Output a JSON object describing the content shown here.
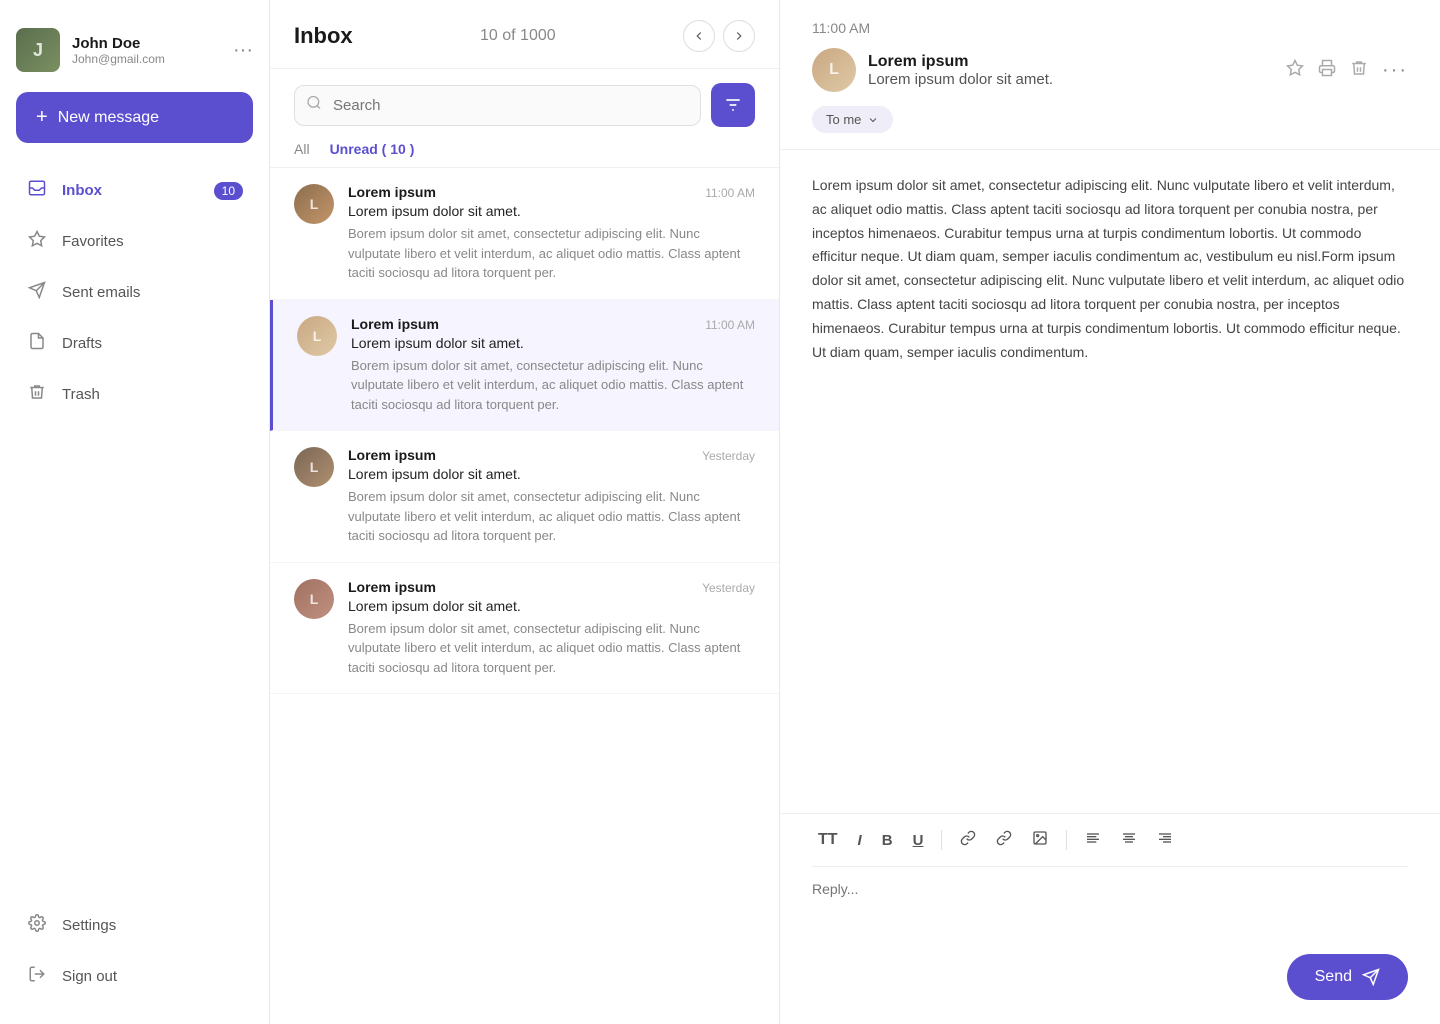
{
  "sidebar": {
    "user": {
      "name": "John Doe",
      "email": "John@gmail.com"
    },
    "new_message_label": "New message",
    "nav_items": [
      {
        "id": "inbox",
        "label": "Inbox",
        "icon": "📥",
        "badge": 10,
        "active": true
      },
      {
        "id": "favorites",
        "label": "Favorites",
        "icon": "☆",
        "badge": null,
        "active": false
      },
      {
        "id": "sent",
        "label": "Sent emails",
        "icon": "▷",
        "badge": null,
        "active": false
      },
      {
        "id": "drafts",
        "label": "Drafts",
        "icon": "📄",
        "badge": null,
        "active": false
      },
      {
        "id": "trash",
        "label": "Trash",
        "icon": "🗑",
        "badge": null,
        "active": false
      }
    ],
    "bottom_items": [
      {
        "id": "settings",
        "label": "Settings",
        "icon": "⚙"
      },
      {
        "id": "signout",
        "label": "Sign out",
        "icon": "↪"
      }
    ]
  },
  "email_list": {
    "title": "Inbox",
    "count": "10 of 1000",
    "search_placeholder": "Search",
    "tab_all": "All",
    "tab_unread": "Unread ( 10 )",
    "emails": [
      {
        "id": 1,
        "sender": "Lorem ipsum",
        "subject": "Lorem ipsum dolor sit amet.",
        "preview": "Borem ipsum dolor sit amet, consectetur adipiscing elit. Nunc vulputate libero et velit interdum, ac aliquet odio mattis. Class aptent taciti sociosqu ad litora torquent per.",
        "time": "11:00 AM",
        "selected": false,
        "avatar_class": "face1"
      },
      {
        "id": 2,
        "sender": "Lorem ipsum",
        "subject": "Lorem ipsum dolor sit amet.",
        "preview": "Borem ipsum dolor sit amet, consectetur adipiscing elit. Nunc vulputate libero et velit interdum, ac aliquet odio mattis. Class aptent taciti sociosqu ad litora torquent per.",
        "time": "11:00 AM",
        "selected": true,
        "avatar_class": "face2"
      },
      {
        "id": 3,
        "sender": "Lorem ipsum",
        "subject": "Lorem ipsum dolor sit amet.",
        "preview": "Borem ipsum dolor sit amet, consectetur adipiscing elit. Nunc vulputate libero et velit interdum, ac aliquet odio mattis. Class aptent taciti sociosqu ad litora torquent per.",
        "time": "Yesterday",
        "selected": false,
        "avatar_class": "face3"
      },
      {
        "id": 4,
        "sender": "Lorem ipsum",
        "subject": "Lorem ipsum dolor sit amet.",
        "preview": "Borem ipsum dolor sit amet, consectetur adipiscing elit. Nunc vulputate libero et velit interdum, ac aliquet odio mattis. Class aptent taciti sociosqu ad litora torquent per.",
        "time": "Yesterday",
        "selected": false,
        "avatar_class": "face4"
      }
    ]
  },
  "email_detail": {
    "time": "11:00 AM",
    "sender_name": "Lorem ipsum",
    "subject": "Lorem ipsum dolor sit amet.",
    "to_label": "To me",
    "body": "Lorem ipsum dolor sit amet, consectetur adipiscing elit. Nunc vulputate libero et velit interdum, ac aliquet odio mattis. Class aptent taciti sociosqu ad litora torquent per conubia nostra, per inceptos himenaeos. Curabitur tempus urna at turpis condimentum lobortis. Ut commodo efficitur neque. Ut diam quam, semper iaculis condimentum ac, vestibulum eu nisl.Form ipsum dolor sit amet, consectetur adipiscing elit. Nunc vulputate libero et velit interdum, ac aliquet odio mattis. Class aptent taciti sociosqu ad litora torquent per conubia nostra, per inceptos himenaeos. Curabitur tempus urna at turpis condimentum lobortis. Ut commodo efficitur neque. Ut diam quam, semper iaculis condimentum.",
    "reply_placeholder": "Reply...",
    "send_label": "Send",
    "toolbar": {
      "text": "TT",
      "italic": "I",
      "bold": "B",
      "underline": "U",
      "link1": "🔗",
      "link2": "🔗",
      "image": "🖼",
      "align_left": "≡",
      "align_center": "≡",
      "align_right": "≡"
    },
    "actions": {
      "star": "☆",
      "print": "🖨",
      "delete": "🗑",
      "more": "···"
    }
  }
}
